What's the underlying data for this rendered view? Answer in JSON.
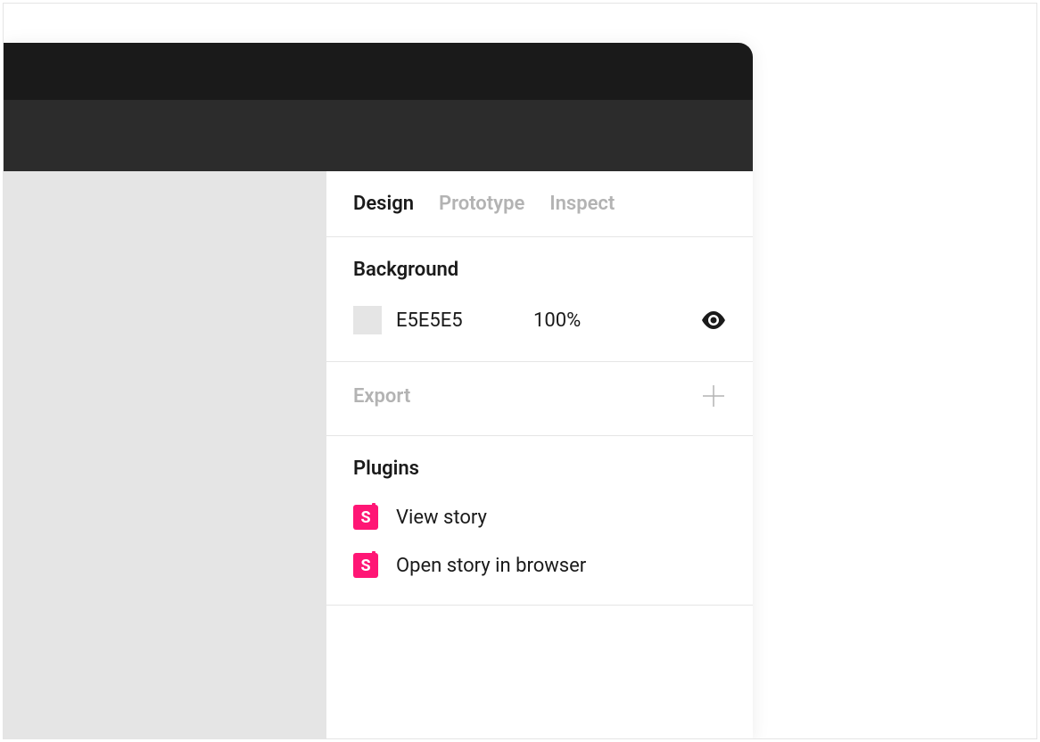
{
  "tabs": {
    "design": "Design",
    "prototype": "Prototype",
    "inspect": "Inspect",
    "active": "design"
  },
  "background": {
    "title": "Background",
    "hex": "E5E5E5",
    "opacity": "100%",
    "swatch_color": "#E5E5E5"
  },
  "export": {
    "title": "Export"
  },
  "plugins": {
    "title": "Plugins",
    "items": [
      {
        "label": "View story"
      },
      {
        "label": "Open story in browser"
      }
    ]
  },
  "icons": {
    "storybook_glyph": "S"
  }
}
